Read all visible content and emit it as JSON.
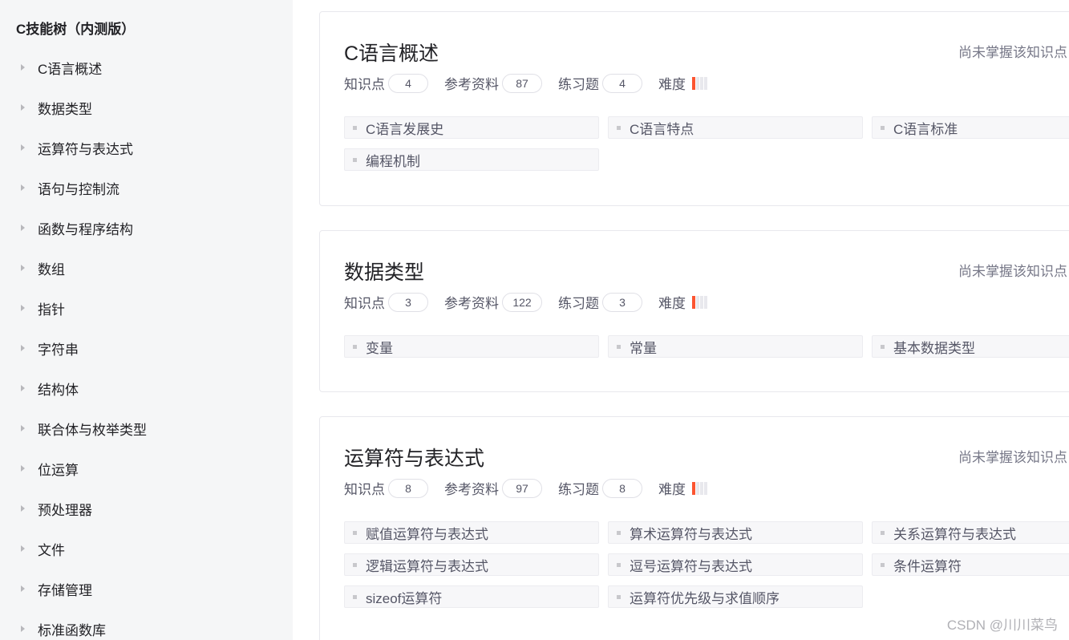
{
  "sidebar": {
    "title": "C技能树（内测版）",
    "items": [
      "C语言概述",
      "数据类型",
      "运算符与表达式",
      "语句与控制流",
      "函数与程序结构",
      "数组",
      "指针",
      "字符串",
      "结构体",
      "联合体与枚举类型",
      "位运算",
      "预处理器",
      "文件",
      "存储管理",
      "标准函数库"
    ]
  },
  "labels": {
    "knowledge": "知识点",
    "references": "参考资料",
    "exercises": "练习题",
    "difficulty": "难度",
    "status": "尚未掌握该知识点"
  },
  "cards": [
    {
      "title": "C语言概述",
      "knowledge": "4",
      "references": "87",
      "exercises": "4",
      "difficulty_level": 1,
      "difficulty_max": 4,
      "chips": [
        "C语言发展史",
        "C语言特点",
        "C语言标准",
        "编程机制"
      ]
    },
    {
      "title": "数据类型",
      "knowledge": "3",
      "references": "122",
      "exercises": "3",
      "difficulty_level": 1,
      "difficulty_max": 4,
      "chips": [
        "变量",
        "常量",
        "基本数据类型"
      ]
    },
    {
      "title": "运算符与表达式",
      "knowledge": "8",
      "references": "97",
      "exercises": "8",
      "difficulty_level": 1,
      "difficulty_max": 4,
      "chips": [
        "赋值运算符与表达式",
        "算术运算符与表达式",
        "关系运算符与表达式",
        "逻辑运算符与表达式",
        "逗号运算符与表达式",
        "条件运算符",
        "sizeof运算符",
        "运算符优先级与求值顺序"
      ]
    }
  ],
  "watermark": "CSDN @川川菜鸟",
  "colors": {
    "difficulty_on": "#fc5531",
    "difficulty_off": "#e8e8ed",
    "sidebar_bg": "#f5f6f7"
  }
}
